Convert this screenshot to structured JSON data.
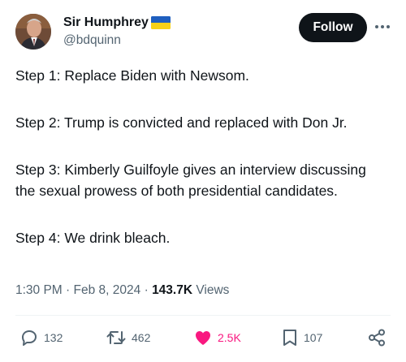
{
  "author": {
    "display_name": "Sir Humphrey",
    "handle": "@bdquinn",
    "flag": "ukraine-flag-icon"
  },
  "follow_label": "Follow",
  "tweet_lines": [
    "Step 1: Replace Biden with Newsom.",
    "Step 2: Trump is convicted and replaced with Don Jr.",
    "Step 3: Kimberly Guilfoyle gives an interview discussing the sexual prowess of both presidential candidates.",
    "Step 4: We drink bleach."
  ],
  "meta": {
    "time": "1:30 PM",
    "separator": "·",
    "date": "Feb 8, 2024",
    "views_count": "143.7K",
    "views_label": "Views"
  },
  "actions": {
    "replies": "132",
    "reposts": "462",
    "likes": "2.5K",
    "bookmarks": "107"
  },
  "colors": {
    "text": "#0f1419",
    "secondary": "#536471",
    "like": "#f91880",
    "flag_blue": "#1f5fbf",
    "flag_yellow": "#f7d117"
  }
}
